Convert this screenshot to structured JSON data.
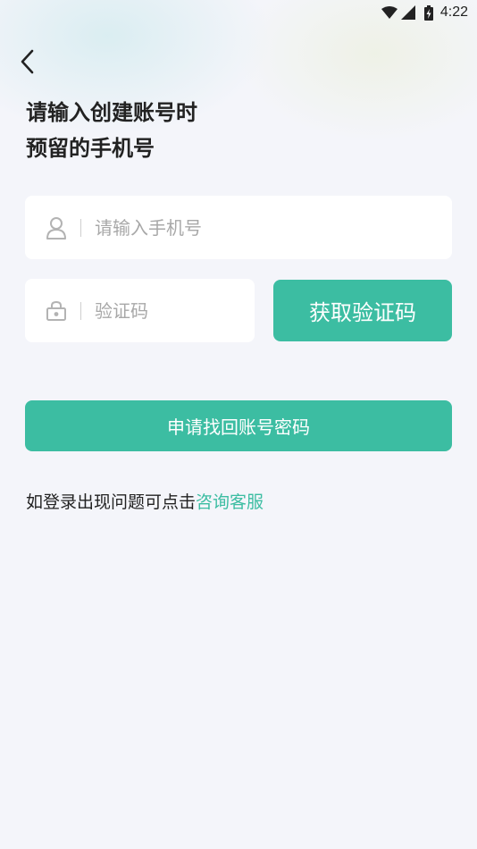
{
  "status_bar": {
    "time": "4:22",
    "icons": [
      "wifi-icon",
      "signal-icon",
      "battery-icon"
    ]
  },
  "header": {
    "back_icon": "chevron-left-icon",
    "title_line1": "请输入创建账号时",
    "title_line2": "预留的手机号"
  },
  "form": {
    "phone": {
      "icon": "user-icon",
      "placeholder": "请输入手机号",
      "value": ""
    },
    "code": {
      "icon": "lock-icon",
      "placeholder": "验证码",
      "value": ""
    },
    "get_code_label": "获取验证码",
    "submit_label": "申请找回账号密码"
  },
  "help": {
    "text": "如登录出现问题可点击",
    "link_label": "咨询客服"
  },
  "colors": {
    "accent": "#3cbda2",
    "background": "#f4f5fa",
    "title_text": "#222222",
    "placeholder": "#a8a8a8"
  }
}
